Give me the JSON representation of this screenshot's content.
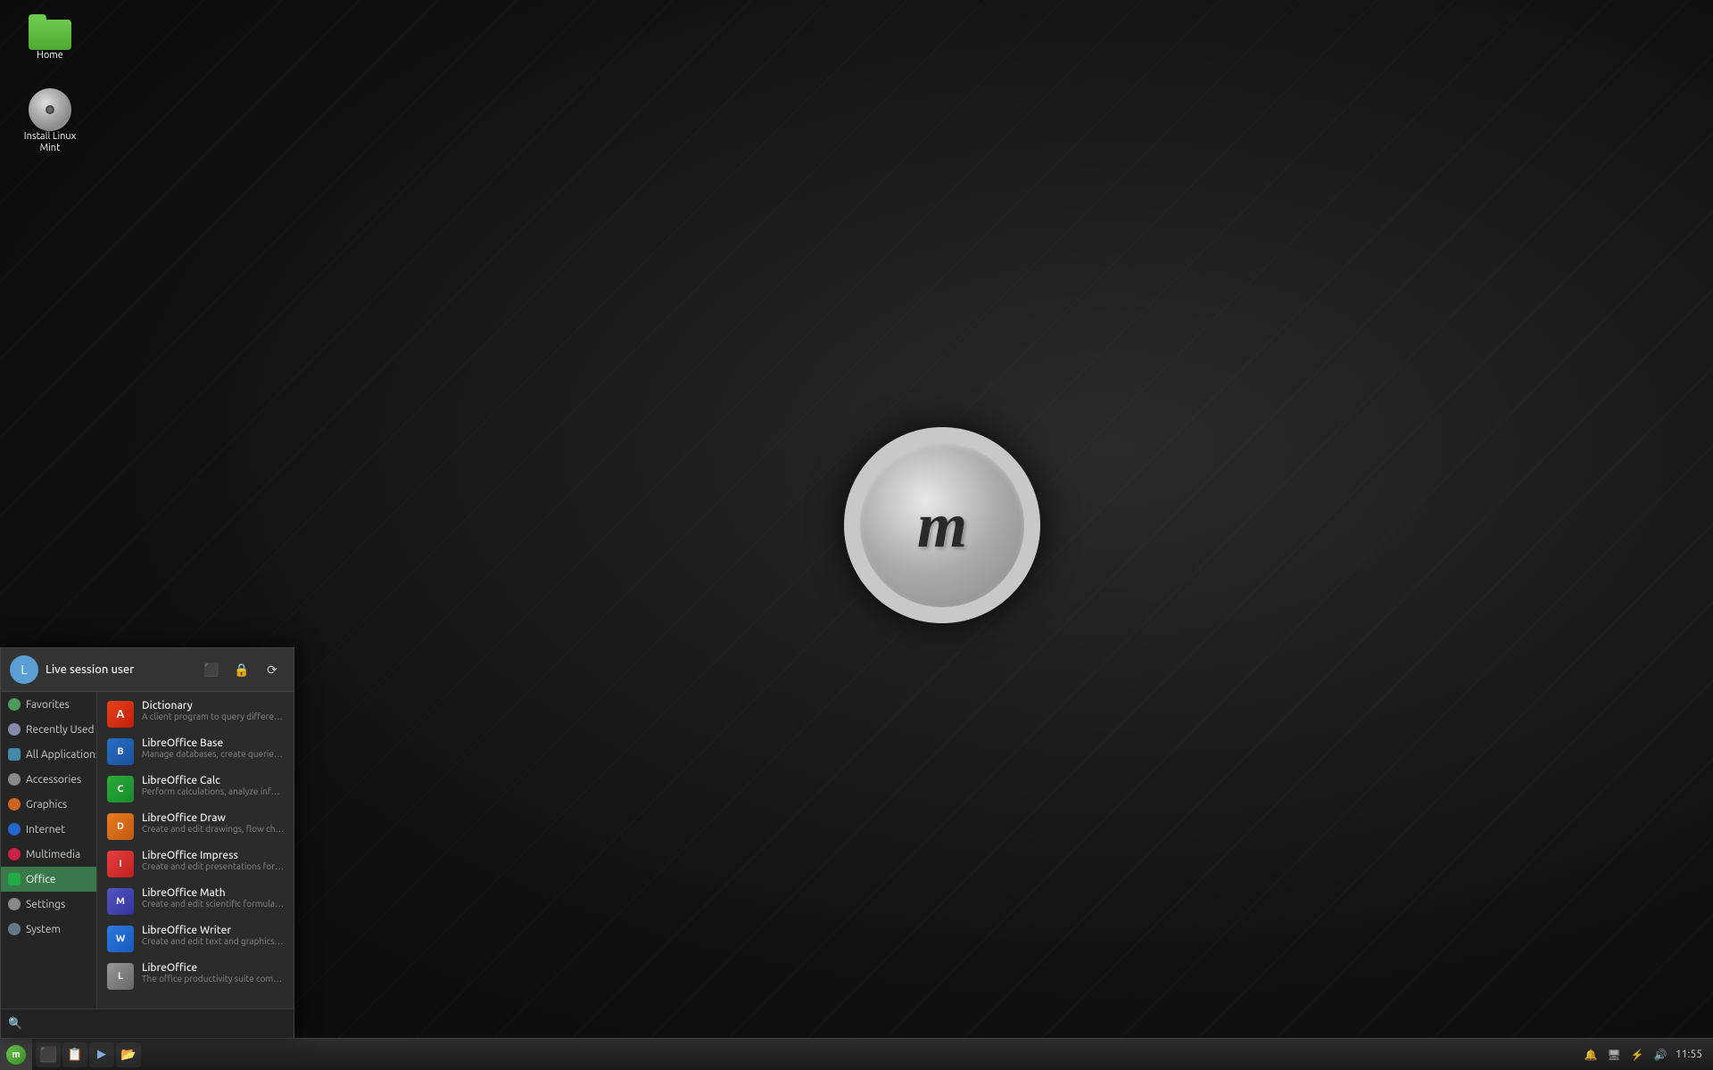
{
  "desktop": {
    "icons": [
      {
        "id": "home",
        "label": "Home",
        "type": "folder"
      },
      {
        "id": "install",
        "label": "Install Linux\nMint",
        "type": "disc"
      }
    ]
  },
  "taskbar": {
    "clock": "11:55",
    "start_label": "m",
    "app_buttons": [
      {
        "id": "btn1",
        "icon": "⬜"
      },
      {
        "id": "btn2",
        "icon": "🗂"
      },
      {
        "id": "btn3",
        "icon": "⬜"
      },
      {
        "id": "btn4",
        "icon": "📂"
      }
    ],
    "tray_icons": [
      "bell",
      "screen",
      "bolt",
      "volume"
    ]
  },
  "start_menu": {
    "header": {
      "user_name": "Live session user",
      "avatar_letter": "L",
      "icons": [
        "files",
        "lock",
        "restart"
      ]
    },
    "sidebar": {
      "items": [
        {
          "id": "favorites",
          "label": "Favorites",
          "color": "#4a9a5a"
        },
        {
          "id": "recently-used",
          "label": "Recently Used",
          "color": "#8888aa"
        },
        {
          "id": "all-applications",
          "label": "All Applications",
          "color": "#4488aa"
        },
        {
          "id": "accessories",
          "label": "Accessories",
          "color": "#888"
        },
        {
          "id": "graphics",
          "label": "Graphics",
          "color": "#cc6622"
        },
        {
          "id": "internet",
          "label": "Internet",
          "color": "#2266cc"
        },
        {
          "id": "multimedia",
          "label": "Multimedia",
          "color": "#cc2244"
        },
        {
          "id": "office",
          "label": "Office",
          "color": "#22aa44"
        },
        {
          "id": "settings",
          "label": "Settings",
          "color": "#888"
        },
        {
          "id": "system",
          "label": "System",
          "color": "#667788"
        }
      ]
    },
    "apps": [
      {
        "id": "dictionary",
        "name": "Dictionary",
        "desc": "A client program to query different dicti...",
        "icon_class": "ico-dict",
        "icon_text": "A"
      },
      {
        "id": "libreoffice-base",
        "name": "LibreOffice Base",
        "desc": "Manage databases, create queries and r...",
        "icon_class": "ico-base",
        "icon_text": "B"
      },
      {
        "id": "libreoffice-calc",
        "name": "LibreOffice Calc",
        "desc": "Perform calculations, analyze informatio...",
        "icon_class": "ico-calc",
        "icon_text": "C"
      },
      {
        "id": "libreoffice-draw",
        "name": "LibreOffice Draw",
        "desc": "Create and edit drawings, flow charts an...",
        "icon_class": "ico-draw",
        "icon_text": "D"
      },
      {
        "id": "libreoffice-impress",
        "name": "LibreOffice Impress",
        "desc": "Create and edit presentations for slides...",
        "icon_class": "ico-impress",
        "icon_text": "I"
      },
      {
        "id": "libreoffice-math",
        "name": "LibreOffice Math",
        "desc": "Create and edit scientific formulas and e...",
        "icon_class": "ico-math",
        "icon_text": "M"
      },
      {
        "id": "libreoffice-writer",
        "name": "LibreOffice Writer",
        "desc": "Create and edit text and graphics in lett...",
        "icon_class": "ico-writer",
        "icon_text": "W"
      },
      {
        "id": "libreoffice",
        "name": "LibreOffice",
        "desc": "The office productivity suite compatible...",
        "icon_class": "ico-lo",
        "icon_text": "L"
      }
    ],
    "search": {
      "placeholder": ""
    }
  }
}
